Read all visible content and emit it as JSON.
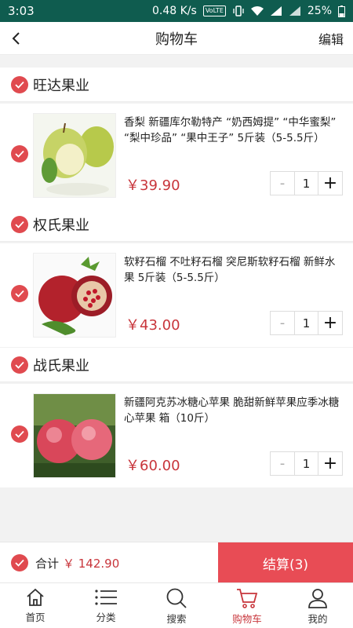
{
  "status": {
    "time": "3:03",
    "network": "0.48 K/s",
    "volte": "VoLTE",
    "battery": "25%"
  },
  "nav": {
    "title": "购物车",
    "edit_label": "编辑"
  },
  "shops": [
    {
      "name": "旺达果业",
      "item": {
        "title": "香梨 新疆库尔勒特产 “奶西姆提” “中华蜜梨” “梨中珍品” “果中王子” 5斤装（5-5.5斤）",
        "price": "￥39.90",
        "qty": "1",
        "image": "pear"
      }
    },
    {
      "name": "权氏果业",
      "item": {
        "title": "软籽石榴 不吐籽石榴 突尼斯软籽石榴 新鲜水果 5斤装（5-5.5斤）",
        "price": "￥43.00",
        "qty": "1",
        "image": "pomegranate"
      }
    },
    {
      "name": "战氏果业",
      "item": {
        "title": "新疆阿克苏冰糖心苹果 脆甜新鲜苹果应季冰糖心苹果 箱（10斤）",
        "price": "￥60.00",
        "qty": "1",
        "image": "apple"
      }
    }
  ],
  "qty_controls": {
    "minus": "-",
    "plus": "+"
  },
  "summary": {
    "total_label": "合计",
    "total_value": "￥ 142.90",
    "checkout_label": "结算(3)"
  },
  "tabs": [
    {
      "label": "首页",
      "icon": "home-icon"
    },
    {
      "label": "分类",
      "icon": "list-icon"
    },
    {
      "label": "搜索",
      "icon": "search-icon"
    },
    {
      "label": "购物车",
      "icon": "cart-icon",
      "active": true
    },
    {
      "label": "我的",
      "icon": "user-icon"
    }
  ],
  "colors": {
    "accent": "#e84c55",
    "price": "#c8353b",
    "statusbar": "#0f5c4f"
  }
}
